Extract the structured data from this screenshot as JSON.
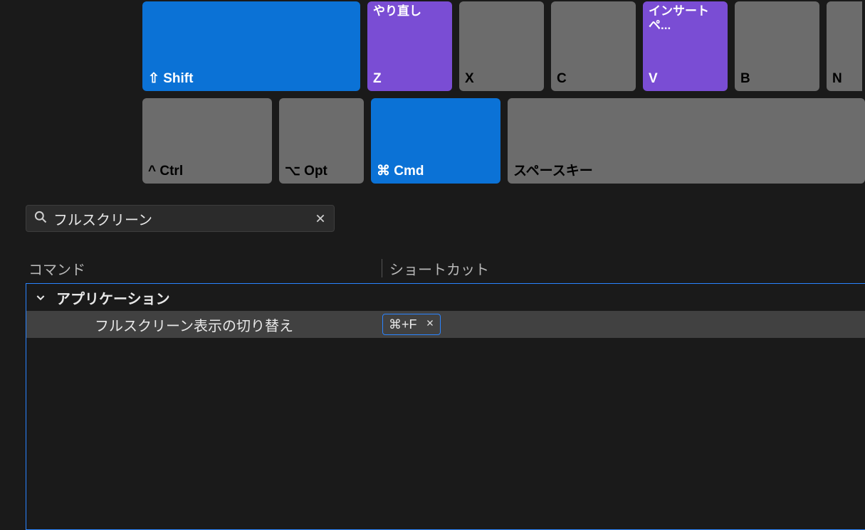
{
  "keyboard": {
    "row1": {
      "shift": {
        "bottom": "⇧ Shift",
        "top": ""
      },
      "z": {
        "bottom": "Z",
        "top": "やり直し"
      },
      "x": {
        "bottom": "X",
        "top": ""
      },
      "c": {
        "bottom": "C",
        "top": ""
      },
      "v": {
        "bottom": "V",
        "top": "インサートペ..."
      },
      "b": {
        "bottom": "B",
        "top": ""
      },
      "n": {
        "bottom": "N",
        "top": ""
      }
    },
    "row2": {
      "ctrl": {
        "bottom": "^ Ctrl"
      },
      "opt": {
        "bottom": "⌥ Opt"
      },
      "cmd": {
        "bottom": "⌘ Cmd"
      },
      "space": {
        "bottom": "スペースキー"
      }
    }
  },
  "search": {
    "value": "フルスクリーン",
    "placeholder": ""
  },
  "table": {
    "col1": "コマンド",
    "col2": "ショートカット"
  },
  "list": {
    "group": "アプリケーション",
    "item": {
      "name": "フルスクリーン表示の切り替え",
      "shortcut": "⌘+F"
    }
  }
}
